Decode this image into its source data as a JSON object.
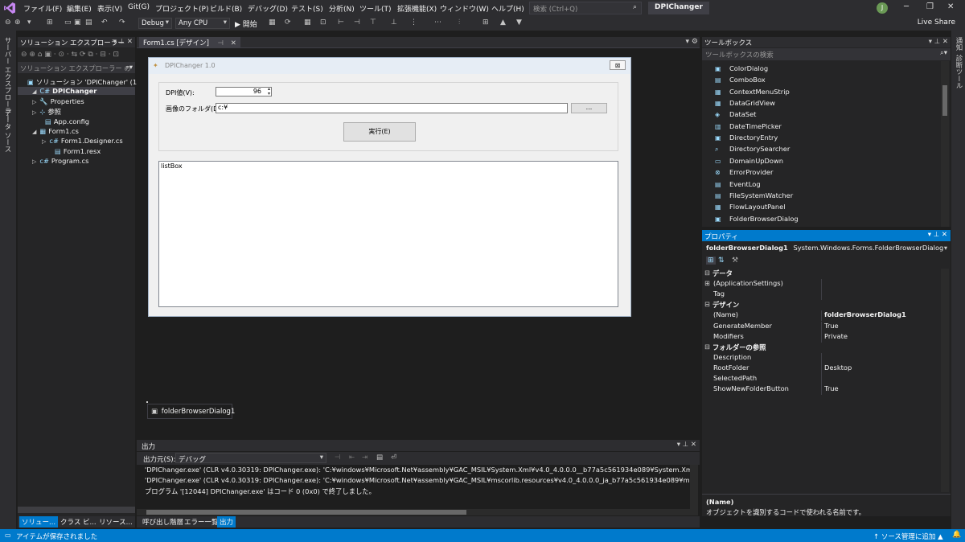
{
  "menubar": {
    "items": [
      "ファイル(F)",
      "編集(E)",
      "表示(V)",
      "Git(G)",
      "プロジェクト(P)",
      "ビルド(B)",
      "デバッグ(D)",
      "テスト(S)",
      "分析(N)",
      "ツール(T)",
      "拡張機能(X)",
      "ウィンドウ(W)",
      "ヘルプ(H)"
    ],
    "search_placeholder": "検索 (Ctrl+Q)",
    "solution_title": "DPIChanger",
    "avatar_initial": "J"
  },
  "toolbar": {
    "config": "Debug",
    "platform": "Any CPU",
    "start_label": "▶ 開始",
    "live_share": "Live Share"
  },
  "left_tabs": [
    "サーバー エクスプローラー",
    "データ ソース"
  ],
  "right_tabs": [
    "通知",
    "診断ツール"
  ],
  "solution_explorer": {
    "title": "ソリューション エクスプローラー",
    "search_placeholder": "ソリューション エクスプローラー の",
    "tree": [
      {
        "label": "ソリューション 'DPIChanger' (1/1 プ",
        "icon": "▣",
        "arrow": ""
      },
      {
        "label": "DPIChanger",
        "icon": "C#",
        "arrow": "◢",
        "bold": true
      },
      {
        "label": "Properties",
        "icon": "🔧",
        "arrow": "▷"
      },
      {
        "label": "参照",
        "icon": "⊹",
        "arrow": "▷"
      },
      {
        "label": "App.config",
        "icon": "▤",
        "arrow": ""
      },
      {
        "label": "Form1.cs",
        "icon": "▦",
        "arrow": "◢"
      },
      {
        "label": "Form1.Designer.cs",
        "icon": "c#",
        "arrow": "▷"
      },
      {
        "label": "Form1.resx",
        "icon": "▤",
        "arrow": ""
      },
      {
        "label": "Program.cs",
        "icon": "c#",
        "arrow": "▷"
      }
    ],
    "bottom_tabs": [
      "ソリュー...",
      "クラス ビ...",
      "リソース..."
    ]
  },
  "document": {
    "tab_label": "Form1.cs [デザイン]"
  },
  "form": {
    "title": "DPIChanger 1.0",
    "close_glyph": "⊠",
    "dpi_label": "DPI値(V):",
    "dpi_value": "96",
    "folder_label": "画像のフォルダ(D):",
    "folder_value": "c:¥",
    "browse_button": "...",
    "run_button": "実行(E)",
    "listbox_label": "listBox"
  },
  "tray": {
    "component": "folderBrowserDialog1"
  },
  "output": {
    "title": "出力",
    "source_label": "出力元(S):",
    "source_value": "デバッグ",
    "lines": [
      "'DPIChanger.exe' (CLR v4.0.30319: DPIChanger.exe): 'C:¥windows¥Microsoft.Net¥assembly¥GAC_MSIL¥System.Xml¥v4.0_4.0.0.0__b77a5c561934e089¥System.Xml.dll",
      "'DPIChanger.exe' (CLR v4.0.30319: DPIChanger.exe): 'C:¥windows¥Microsoft.Net¥assembly¥GAC_MSIL¥mscorlib.resources¥v4.0_4.0.0.0_ja_b77a5c561934e089¥mscor",
      "プログラム '[12044] DPIChanger.exe' はコード 0 (0x0) で終了しました。"
    ],
    "bottom_tabs": [
      "呼び出し階層",
      "エラー一覧",
      "出力"
    ]
  },
  "toolbox": {
    "title": "ツールボックス",
    "search_placeholder": "ツールボックスの検索",
    "items": [
      {
        "label": "ColorDialog",
        "icon": "▣"
      },
      {
        "label": "ComboBox",
        "icon": "▤"
      },
      {
        "label": "ContextMenuStrip",
        "icon": "▦"
      },
      {
        "label": "DataGridView",
        "icon": "▦"
      },
      {
        "label": "DataSet",
        "icon": "◈"
      },
      {
        "label": "DateTimePicker",
        "icon": "▥"
      },
      {
        "label": "DirectoryEntry",
        "icon": "▣"
      },
      {
        "label": "DirectorySearcher",
        "icon": "⌕"
      },
      {
        "label": "DomainUpDown",
        "icon": "▭"
      },
      {
        "label": "ErrorProvider",
        "icon": "⊗"
      },
      {
        "label": "EventLog",
        "icon": "▤"
      },
      {
        "label": "FileSystemWatcher",
        "icon": "▤"
      },
      {
        "label": "FlowLayoutPanel",
        "icon": "▦"
      },
      {
        "label": "FolderBrowserDialog",
        "icon": "▣"
      }
    ]
  },
  "properties": {
    "title": "プロパティ",
    "object_name": "folderBrowserDialog1",
    "object_type": "System.Windows.Forms.FolderBrowserDialog",
    "rows": [
      {
        "name": "データ",
        "value": "",
        "category": true,
        "toggle": "⊟"
      },
      {
        "name": "(ApplicationSettings)",
        "value": "",
        "category": false,
        "toggle": "⊞"
      },
      {
        "name": "Tag",
        "value": "",
        "category": false,
        "toggle": ""
      },
      {
        "name": "デザイン",
        "value": "",
        "category": true,
        "toggle": "⊟"
      },
      {
        "name": "(Name)",
        "value": "folderBrowserDialog1",
        "category": false,
        "toggle": "",
        "bold_value": true
      },
      {
        "name": "GenerateMember",
        "value": "True",
        "category": false,
        "toggle": ""
      },
      {
        "name": "Modifiers",
        "value": "Private",
        "category": false,
        "toggle": ""
      },
      {
        "name": "フォルダーの参照",
        "value": "",
        "category": true,
        "toggle": "⊟"
      },
      {
        "name": "Description",
        "value": "",
        "category": false,
        "toggle": ""
      },
      {
        "name": "RootFolder",
        "value": "Desktop",
        "category": false,
        "toggle": ""
      },
      {
        "name": "SelectedPath",
        "value": "",
        "category": false,
        "toggle": ""
      },
      {
        "name": "ShowNewFolderButton",
        "value": "True",
        "category": false,
        "toggle": ""
      }
    ],
    "desc_title": "(Name)",
    "desc_text": "オブジェクトを識別するコードで使われる名前です。"
  },
  "statusbar": {
    "message": "アイテムが保存されました",
    "source_control": "↑ ソース管理に追加 ▲"
  },
  "colors": {
    "accent": "#007acc",
    "background": "#1e1e1e",
    "panel": "#252526",
    "chrome": "#2d2d30"
  }
}
